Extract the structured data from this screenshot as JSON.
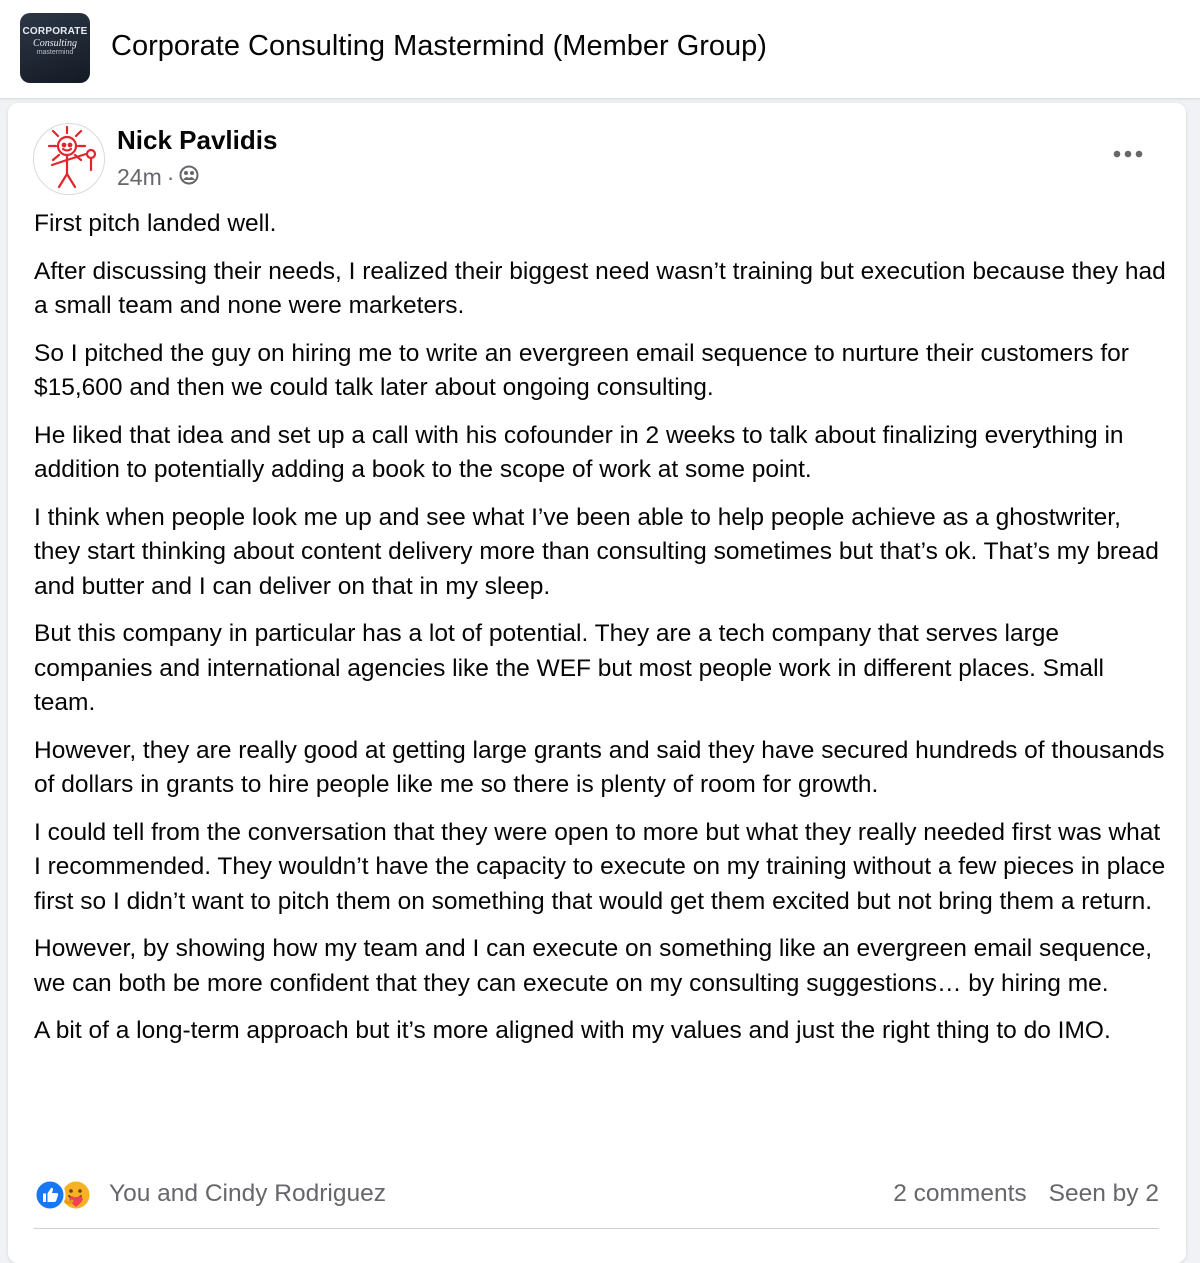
{
  "group": {
    "logo_text": [
      "CORPORATE",
      "Consulting",
      "mastermind"
    ],
    "title": "Corporate Consulting Mastermind (Member Group)"
  },
  "post": {
    "author": "Nick Pavlidis",
    "time": "24m",
    "separator": "·",
    "privacy_icon": "group-members-icon",
    "paragraphs": [
      "First pitch landed well.",
      "After discussing their needs, I realized their biggest need wasn’t training but execution because they had a small team and none were marketers.",
      "So I pitched the guy on hiring me to write an evergreen email sequence to nurture their customers for $15,600 and then we could talk later about ongoing consulting.",
      "He liked that idea and set up a call with his cofounder in 2 weeks to talk about finalizing everything in addition to potentially adding a book to the scope of work at some point.",
      "I think when people look me up and see what I’ve been able to help people achieve as a ghostwriter, they start thinking about content delivery more than consulting sometimes but that’s ok. That’s my bread and butter and I can deliver on that in my sleep.",
      "But this company in particular has a lot of potential. They are a tech company that serves large companies and international agencies like the WEF but most people work in different places. Small team.",
      "However, they are really good at getting large grants and said they have secured hundreds of thousands of dollars in grants to hire people like me so there is plenty of room for growth.",
      "I could tell from the conversation that they were open to more but what they really needed first was what I recommended. They wouldn’t have the capacity to execute on my training without a few pieces in place first so I didn’t want to pitch them on something that would get them excited but not bring them a return.",
      "However, by showing how my team and I can execute on something like an evergreen email sequence, we can both be more confident that they can execute on my consulting suggestions… by hiring me.",
      "A bit of a long-term approach but it’s more aligned with my values and just the right thing to do IMO."
    ],
    "reactions_text": "You and Cindy Rodriguez",
    "reaction_icons": [
      "like-icon",
      "care-icon"
    ],
    "comments": "2 comments",
    "seen_by": "Seen by 2"
  },
  "colors": {
    "like_blue": "#1877f2",
    "care_yellow": "#f7b125",
    "care_heart": "#f33e58",
    "meta_gray": "#65676b",
    "page_bg": "#f0f2f5"
  }
}
